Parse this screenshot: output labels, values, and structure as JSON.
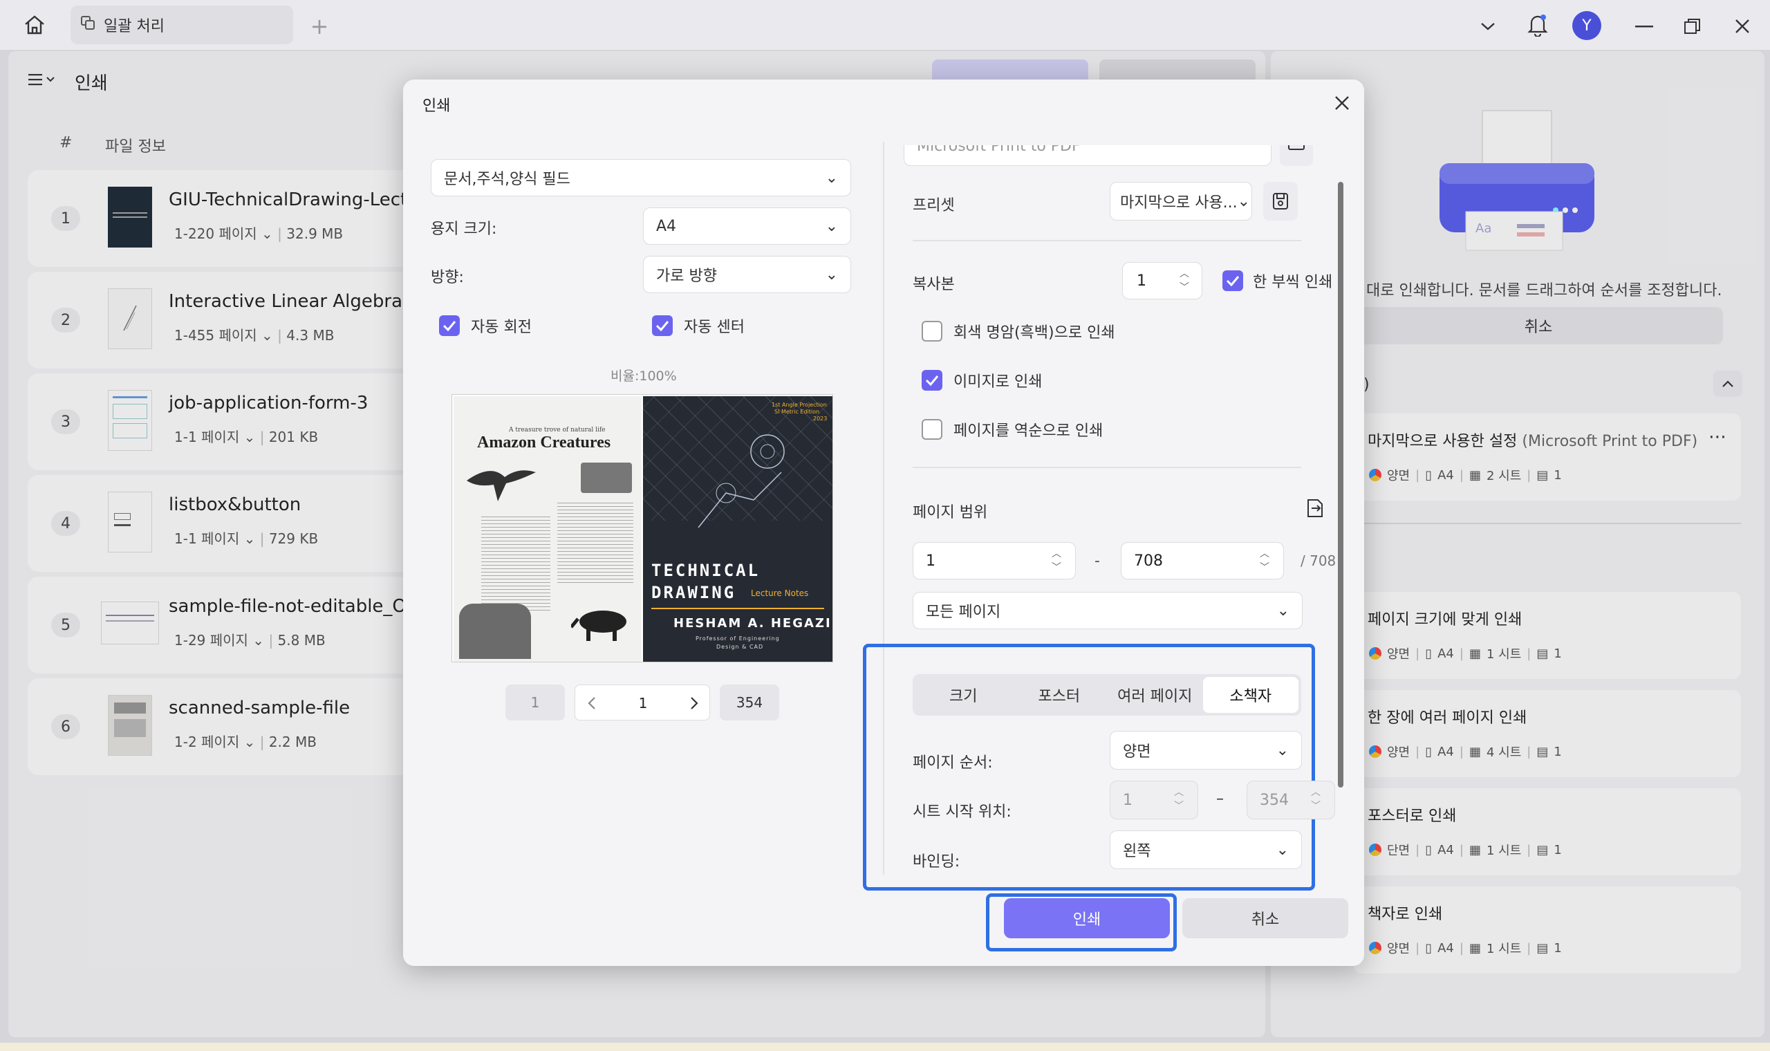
{
  "titlebar": {
    "tab_label": "일괄 처리",
    "avatar_letter": "Y"
  },
  "left": {
    "header_title": "인쇄",
    "col_num": "#",
    "col_info": "파일 정보",
    "files": [
      {
        "num": "1",
        "title": "GIU-TechnicalDrawing-LectureN",
        "pages": "1-220 페이지",
        "size": "32.9 MB"
      },
      {
        "num": "2",
        "title": "Interactive Linear Algebra",
        "pages": "1-455 페이지",
        "size": "4.3 MB"
      },
      {
        "num": "3",
        "title": "job-application-form-3",
        "pages": "1-1 페이지",
        "size": "201 KB"
      },
      {
        "num": "4",
        "title": "listbox&button",
        "pages": "1-1 페이지",
        "size": "729 KB"
      },
      {
        "num": "5",
        "title": "sample-file-not-editable_OCR",
        "pages": "1-29 페이지",
        "size": "5.8 MB"
      },
      {
        "num": "6",
        "title": "scanned-sample-file",
        "pages": "1-2 페이지",
        "size": "2.2 MB"
      }
    ]
  },
  "right": {
    "hint": "대로 인쇄합니다. 문서를 드래그하여 순서를 조정합니다.",
    "cancel": "취소",
    "section_head": ")",
    "last_used": {
      "title": "마지막으로 사용한 설정",
      "sub": "(Microsoft Print to PDF)",
      "duplex": "양면",
      "paper": "A4",
      "sheets": "2 시트",
      "copies": "1"
    },
    "presets": [
      {
        "title": "페이지 크기에 맞게 인쇄",
        "duplex": "양면",
        "paper": "A4",
        "sheets": "1 시트",
        "copies": "1"
      },
      {
        "title": "한 장에 여러 페이지 인쇄",
        "duplex": "양면",
        "paper": "A4",
        "sheets": "4 시트",
        "copies": "1"
      },
      {
        "title": "포스터로 인쇄",
        "duplex": "단면",
        "paper": "A4",
        "sheets": "1 시트",
        "copies": "1"
      },
      {
        "title": "책자로 인쇄",
        "duplex": "양면",
        "paper": "A4",
        "sheets": "1 시트",
        "copies": "1"
      }
    ]
  },
  "dialog": {
    "title": "인쇄",
    "content_select": "문서,주석,양식 필드",
    "paper_size_label": "용지 크기:",
    "paper_size": "A4",
    "orientation_label": "방향:",
    "orientation": "가로 방향",
    "auto_rotate": "자동 회전",
    "auto_center": "자동 센터",
    "scale": "비율:100%",
    "preview": {
      "left_title": "Amazon Creatures",
      "left_subtitle": "A treasure trove of natural life",
      "right_tag1": "1st Angle Projection",
      "right_tag2": "SI Metric Edition",
      "right_tag3": "2023",
      "right_title1": "TECHNICAL",
      "right_title2": "DRAWING",
      "right_sub": "Lecture Notes",
      "right_author": "HESHAM A. HEGAZI",
      "right_author_sub1": "Professor of Engineering",
      "right_author_sub2": "Design & CAD"
    },
    "pager": {
      "first": "1",
      "current": "1",
      "last": "354"
    },
    "printer_name": "Microsoft Print to PDF",
    "preset_label": "프리셋",
    "preset_value": "마지막으로 사용...",
    "copies_label": "복사본",
    "copies_value": "1",
    "collate": "한 부씩 인쇄",
    "grayscale": "회색 명암(흑백)으로 인쇄",
    "as_image": "이미지로 인쇄",
    "reverse": "페이지를 역순으로 인쇄",
    "range_label": "페이지 범위",
    "range_from": "1",
    "range_dash": "-",
    "range_to": "708",
    "range_total": "/ 708",
    "range_select": "모든 페이지",
    "tabs": [
      "크기",
      "포스터",
      "여러 페이지",
      "소책자"
    ],
    "page_order_label": "페이지 순서:",
    "page_order": "양면",
    "sheet_start_label": "시트 시작 위치:",
    "sheet_from": "1",
    "sheet_dash": "–",
    "sheet_to": "354",
    "binding_label": "바인딩:",
    "binding": "왼쪽",
    "print_btn": "인쇄",
    "cancel_btn": "취소"
  }
}
